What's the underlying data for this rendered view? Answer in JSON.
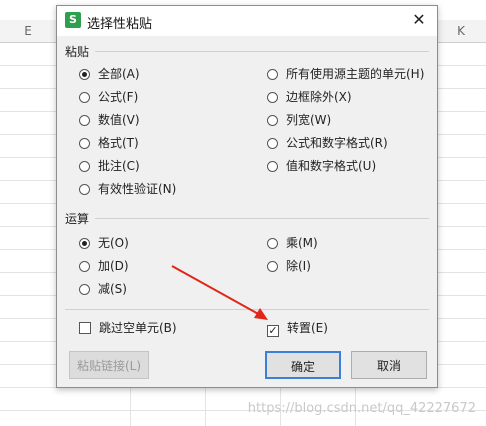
{
  "sheet": {
    "columns": [
      {
        "label": "E"
      },
      {
        "label": "K"
      }
    ]
  },
  "dialog": {
    "title": "选择性粘贴",
    "app_icon_letter": "S",
    "close_glyph": "✕",
    "paste_group": {
      "label": "粘贴",
      "options_left": [
        {
          "label": "全部(A)",
          "selected": true
        },
        {
          "label": "公式(F)",
          "selected": false
        },
        {
          "label": "数值(V)",
          "selected": false
        },
        {
          "label": "格式(T)",
          "selected": false
        },
        {
          "label": "批注(C)",
          "selected": false
        },
        {
          "label": "有效性验证(N)",
          "selected": false
        }
      ],
      "options_right": [
        {
          "label": "所有使用源主题的单元(H)",
          "selected": false
        },
        {
          "label": "边框除外(X)",
          "selected": false
        },
        {
          "label": "列宽(W)",
          "selected": false
        },
        {
          "label": "公式和数字格式(R)",
          "selected": false
        },
        {
          "label": "值和数字格式(U)",
          "selected": false
        }
      ]
    },
    "operation_group": {
      "label": "运算",
      "options_left": [
        {
          "label": "无(O)",
          "selected": true
        },
        {
          "label": "加(D)",
          "selected": false
        },
        {
          "label": "减(S)",
          "selected": false
        }
      ],
      "options_right": [
        {
          "label": "乘(M)",
          "selected": false
        },
        {
          "label": "除(I)",
          "selected": false
        }
      ]
    },
    "skip_blanks": {
      "label": "跳过空单元(B)",
      "checked": false
    },
    "transpose": {
      "label": "转置(E)",
      "checked": true
    },
    "paste_link_label": "粘贴链接(L)",
    "ok_label": "确定",
    "cancel_label": "取消"
  },
  "colors": {
    "arrow": "#e0251b",
    "ok_border": "#3c7fd8",
    "app_icon": "#2e9e4f"
  },
  "watermark": "https://blog.csdn.net/qq_42227672"
}
